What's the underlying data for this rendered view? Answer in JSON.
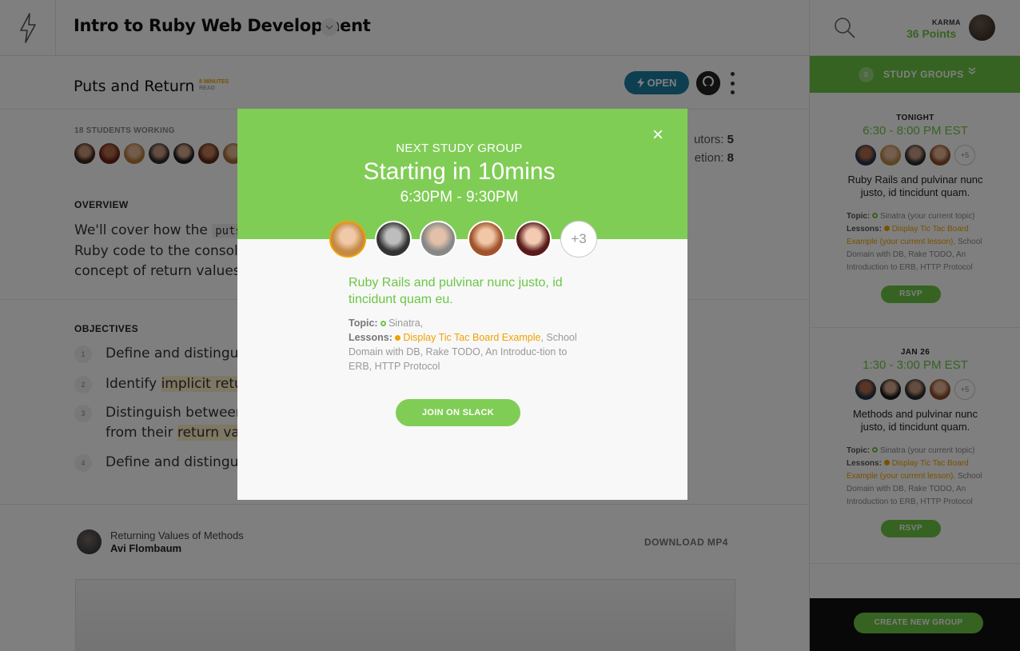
{
  "header": {
    "course_title": "Intro to Ruby Web Development",
    "karma_label": "KARMA",
    "karma_points": "36 Points"
  },
  "lesson": {
    "title": "Puts and Return",
    "read_time": "8 MINUTES",
    "read_label": "READ",
    "open_label": "OPEN",
    "students_working": "18 STUDENTS WORKING",
    "tutors_label": "utors:",
    "tutors_value": "5",
    "completion_label": "etion:",
    "completion_value": "8",
    "overview_heading": "OVERVIEW",
    "overview_p1": "We'll cover how the",
    "overview_code": "puts",
    "overview_p2": "Ruby code to the  console",
    "overview_p3": "concept of return values",
    "objectives_heading": "OBJECTIVES",
    "objectives": [
      {
        "num": "1",
        "text": "Define and distingui",
        "highlight": "",
        "text2": ""
      },
      {
        "num": "2",
        "text": "Identify ",
        "highlight": "implicit retu",
        "text2": ""
      },
      {
        "num": "3",
        "text": "Distinguish between",
        "highlight": "return val",
        "text2": "from their "
      },
      {
        "num": "4",
        "text": "Define and distingui",
        "highlight": "",
        "text2": ""
      }
    ],
    "video_title": "Returning Values of Methods",
    "video_author": "Avi Flombaum",
    "download_label": "DOWNLOAD MP4"
  },
  "sidebar": {
    "count": "0",
    "label": "STUDY GROUPS",
    "groups": [
      {
        "when": "TONIGHT",
        "time": "6:30 - 8:00 PM EST",
        "more": "+5",
        "desc": "Ruby Rails and pulvinar nunc justo, id tincidunt quam.",
        "topic_label": "Topic:",
        "topic": "Sinatra (your current topic)",
        "lessons_label": "Lessons:",
        "lesson_current": "Display Tic Tac Board Example (your current lesson),",
        "lessons_rest": "School Domain with DB, Rake TODO, An Introduction to ERB, HTTP Protocol",
        "rsvp": "RSVP"
      },
      {
        "when": "JAN 26",
        "time": "1:30 - 3:00 PM EST",
        "more": "+5",
        "desc": "Methods and pulvinar nunc justo, id tincidunt quam.",
        "topic_label": "Topic:",
        "topic": "Sinatra (your current topic)",
        "lessons_label": "Lessons:",
        "lesson_current": "Display Tic Tac Board Example (your current lesson),",
        "lessons_rest": "School Domain with DB, Rake TODO, An Introduction to ERB, HTTP Protocol",
        "rsvp": "RSVP"
      }
    ],
    "create_label": "CREATE NEW GROUP"
  },
  "modal": {
    "kicker": "NEXT STUDY GROUP",
    "starting": "Starting in 10mins",
    "time": "6:30PM - 9:30PM",
    "more": "+3",
    "desc": "Ruby Rails and pulvinar nunc justo, id tincidunt quam eu.",
    "topic_label": "Topic:",
    "topic": "Sinatra,",
    "lessons_label": "Lessons:",
    "lesson_current": "Display Tic Tac Board Example",
    "lessons_rest": "School Domain with DB, Rake TODO, An Introduc-tion to ERB, HTTP Protocol",
    "join_label": "JOIN ON SLACK"
  },
  "colors": {
    "brand_green": "#6cc644",
    "modal_green": "#80cd56",
    "accent_orange": "#f0a200",
    "open_blue": "#1a7fa0"
  }
}
